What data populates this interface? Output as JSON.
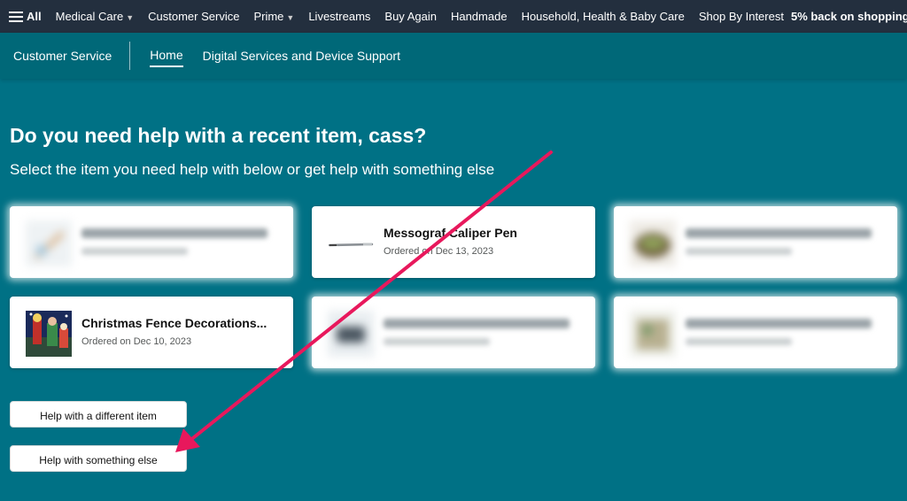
{
  "topnav": {
    "all_label": "All",
    "items": [
      {
        "label": "Medical Care",
        "has_caret": true
      },
      {
        "label": "Customer Service",
        "has_caret": false
      },
      {
        "label": "Prime",
        "has_caret": true
      },
      {
        "label": "Livestreams",
        "has_caret": false
      },
      {
        "label": "Buy Again",
        "has_caret": false
      },
      {
        "label": "Handmade",
        "has_caret": false
      },
      {
        "label": "Household, Health & Baby Care",
        "has_caret": false
      },
      {
        "label": "Shop By Interest",
        "has_caret": false
      }
    ],
    "promo": "5% back on shopping"
  },
  "subnav": {
    "brand": "Customer Service",
    "tabs": [
      {
        "label": "Home",
        "active": true
      },
      {
        "label": "Digital Services and Device Support",
        "active": false
      }
    ]
  },
  "main": {
    "heading": "Do you need help with a recent item, cass?",
    "subheading": "Select the item you need help with below or get help with something else",
    "items": [
      {
        "title": "",
        "date": "",
        "blurred": true,
        "thumb": "blurred-product-thumbnail"
      },
      {
        "title": "Messograf Caliper Pen",
        "date": "Ordered on Dec 13, 2023",
        "blurred": false,
        "thumb": "pen-thumbnail"
      },
      {
        "title": "",
        "date": "",
        "blurred": true,
        "thumb": "blurred-product-thumbnail"
      },
      {
        "title": "Christmas Fence Decorations...",
        "date": "Ordered on Dec 10, 2023",
        "blurred": false,
        "thumb": "christmas-decoration-thumbnail"
      },
      {
        "title": "",
        "date": "",
        "blurred": true,
        "thumb": "blurred-product-thumbnail"
      },
      {
        "title": "",
        "date": "",
        "blurred": true,
        "thumb": "blurred-product-thumbnail"
      }
    ],
    "buttons": {
      "different_item": "Help with a different item",
      "something_else": "Help with something else"
    }
  },
  "colors": {
    "page_bg": "#007185",
    "nav_bg": "#232f3e",
    "annotation_arrow": "#e8185c"
  }
}
